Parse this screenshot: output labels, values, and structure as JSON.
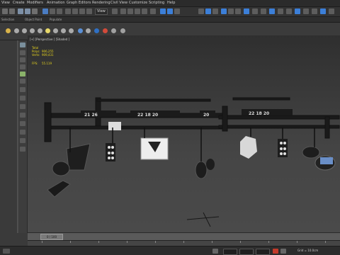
{
  "menu": [
    "View",
    "Create",
    "Modifiers",
    "Animation",
    "Graph Editors",
    "Rendering",
    "Civil View",
    "Customize",
    "Scripting",
    "Help"
  ],
  "ribbon": {
    "left": "Selection",
    "mid": "Object Paint",
    "right": "Populate"
  },
  "toolbar": {
    "view_mode": "View"
  },
  "viewport": {
    "label": "[+] [Perspective ] [Shaded ]",
    "stats": {
      "total_label": "Total",
      "polys_label": "Polys:",
      "polys_value": "906,255",
      "verts_label": "Verts:",
      "verts_value": "909,431",
      "fps_label": "FPS:",
      "fps_value": "55.119"
    },
    "sign_numbers": {
      "left": "21  26",
      "mid": "22  18  20",
      "right": "20",
      "right2": "22  18  20"
    }
  },
  "timeline": {
    "frame": "0 / 100"
  },
  "status": {
    "grid": "Grid = 10.0cm"
  },
  "colors": {
    "accent": "#3c7fd8",
    "stats": "#e5d21e",
    "viewport_bg": "#3f3f3f"
  }
}
